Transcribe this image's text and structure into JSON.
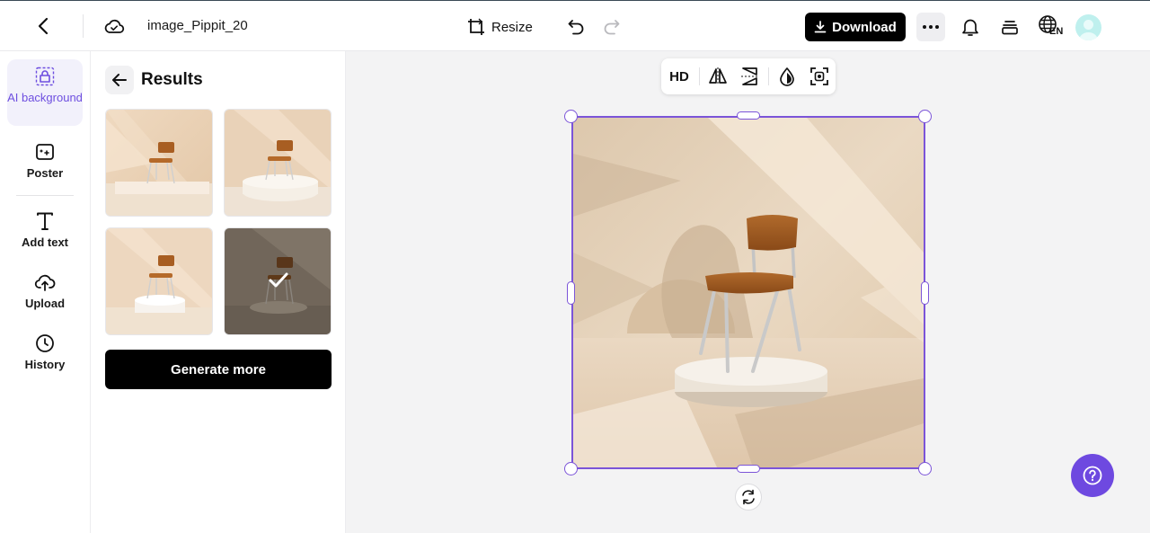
{
  "header": {
    "file_name": "image_Pippit_20",
    "resize_label": "Resize",
    "download_label": "Download",
    "language_code": "EN"
  },
  "rail": {
    "items": [
      {
        "label": "AI background",
        "icon": "ai-background-icon",
        "active": true
      },
      {
        "label": "Poster",
        "icon": "poster-icon"
      },
      {
        "label": "Add text",
        "icon": "text-icon"
      },
      {
        "label": "Upload",
        "icon": "upload-cloud-icon"
      },
      {
        "label": "History",
        "icon": "clock-icon"
      }
    ]
  },
  "panel": {
    "title": "Results",
    "generate_label": "Generate more",
    "selected_result": 4
  },
  "toolbar": {
    "hd_label": "HD"
  },
  "colors": {
    "accent": "#7b54d8",
    "help_button": "#6e49e0",
    "primary_button": "#000000",
    "active_rail_bg": "#f2f1fb"
  }
}
